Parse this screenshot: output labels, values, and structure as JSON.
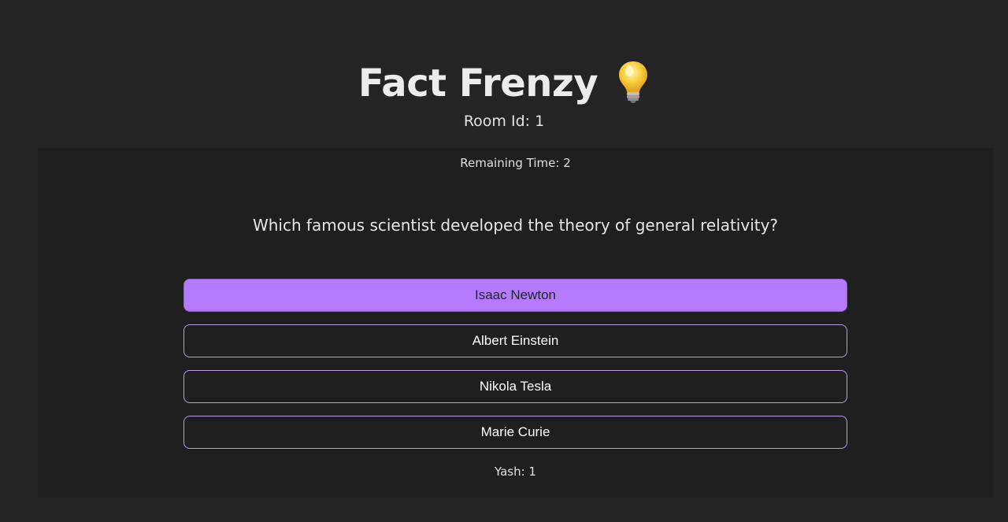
{
  "header": {
    "title": "Fact Frenzy",
    "title_icon": "lightbulb-icon",
    "room_label": "Room Id: 1"
  },
  "quiz": {
    "remaining_time": "Remaining Time: 2",
    "question": "Which famous scientist developed the theory of general relativity?",
    "options": [
      {
        "label": "Isaac Newton",
        "selected": true
      },
      {
        "label": "Albert Einstein",
        "selected": false
      },
      {
        "label": "Nikola Tesla",
        "selected": false
      },
      {
        "label": "Marie Curie",
        "selected": false
      }
    ],
    "score": "Yash: 1"
  },
  "colors": {
    "background": "#242424",
    "card": "#1f1f1f",
    "accent": "#b57bff",
    "option_border": "#b69ce8"
  }
}
